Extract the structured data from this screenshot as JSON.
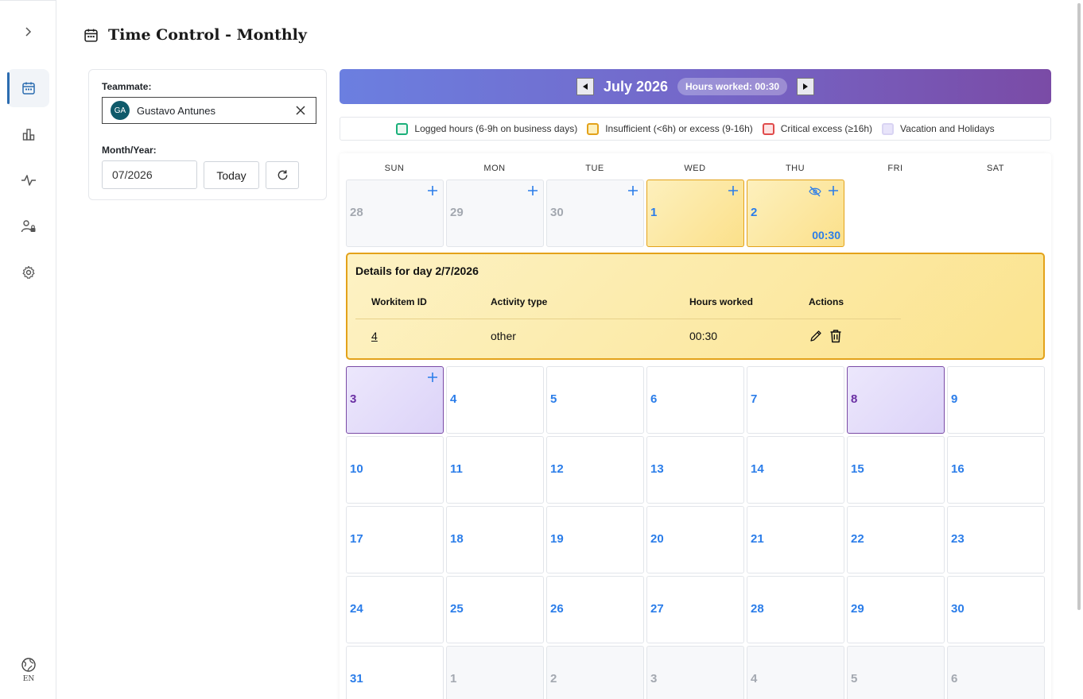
{
  "sidebar": {
    "toggle_icon": "chevron-right-icon",
    "items": [
      {
        "id": "calendar",
        "icon": "calendar-icon",
        "active": true
      },
      {
        "id": "charts",
        "icon": "bar-chart-icon",
        "active": false
      },
      {
        "id": "activity",
        "icon": "activity-icon",
        "active": false
      },
      {
        "id": "users",
        "icon": "user-lock-icon",
        "active": false
      },
      {
        "id": "settings",
        "icon": "gear-icon",
        "active": false
      }
    ],
    "language": "EN"
  },
  "header": {
    "title": "Time Control - Monthly",
    "icon": "calendar-icon"
  },
  "filters": {
    "teammate_label": "Teammate:",
    "teammate_initials": "GA",
    "teammate_name": "Gustavo Antunes",
    "month_label": "Month/Year:",
    "month_value": "07/2026",
    "today_label": "Today",
    "refresh_icon": "refresh-icon"
  },
  "calendar": {
    "month_title": "July 2026",
    "hours_worked": "Hours worked: 00:30",
    "colors": {
      "logged": "#1bb07a",
      "insufficient": "#e3a21a",
      "critical": "#e04b4b",
      "vacation": "#c9c2ef",
      "day_number": "#2b7de9",
      "banner_start": "#6b7fe0",
      "banner_end": "#7a4ba6"
    },
    "legend": [
      {
        "label": "Logged hours (6-9h on business days)",
        "color": "#1bb07a",
        "fill": "#eaf8f1"
      },
      {
        "label": "Insufficient (<6h) or excess (9-16h)",
        "color": "#e3a21a",
        "fill": "#fdf0bd"
      },
      {
        "label": "Critical excess (≥16h)",
        "color": "#e04b4b",
        "fill": "#fde3e3"
      },
      {
        "label": "Vacation and Holidays",
        "color": "#d9d4f3",
        "fill": "#e8e4fa"
      }
    ],
    "weekdays": [
      "SUN",
      "MON",
      "TUE",
      "WED",
      "THU",
      "FRI",
      "SAT"
    ],
    "week1": [
      {
        "n": "28",
        "type": "other",
        "plus": true
      },
      {
        "n": "29",
        "type": "other",
        "plus": true
      },
      {
        "n": "30",
        "type": "other",
        "plus": true
      },
      {
        "n": "1",
        "type": "insufficient",
        "plus": true
      },
      {
        "n": "2",
        "type": "insufficient",
        "plus": true,
        "eyeoff": true,
        "hours": "00:30"
      }
    ],
    "details": {
      "title": "Details for day 2/7/2026",
      "columns": [
        "Workitem ID",
        "Activity type",
        "Hours worked",
        "Actions"
      ],
      "rows": [
        {
          "workitem": "4",
          "activity": "other",
          "hours": "00:30"
        }
      ]
    },
    "weeks": [
      [
        {
          "n": "3",
          "type": "vacation",
          "plus": true
        },
        {
          "n": "4"
        },
        {
          "n": "5"
        },
        {
          "n": "6"
        },
        {
          "n": "7"
        },
        {
          "n": "8",
          "type": "vacation"
        },
        {
          "n": "9"
        }
      ],
      [
        {
          "n": "10"
        },
        {
          "n": "11"
        },
        {
          "n": "12"
        },
        {
          "n": "13"
        },
        {
          "n": "14"
        },
        {
          "n": "15"
        },
        {
          "n": "16"
        }
      ],
      [
        {
          "n": "17"
        },
        {
          "n": "18"
        },
        {
          "n": "19"
        },
        {
          "n": "20"
        },
        {
          "n": "21"
        },
        {
          "n": "22"
        },
        {
          "n": "23"
        }
      ],
      [
        {
          "n": "24"
        },
        {
          "n": "25"
        },
        {
          "n": "26"
        },
        {
          "n": "27"
        },
        {
          "n": "28"
        },
        {
          "n": "29"
        },
        {
          "n": "30"
        }
      ],
      [
        {
          "n": "31"
        },
        {
          "n": "1",
          "type": "other"
        },
        {
          "n": "2",
          "type": "other"
        },
        {
          "n": "3",
          "type": "other"
        },
        {
          "n": "4",
          "type": "other"
        },
        {
          "n": "5",
          "type": "other"
        },
        {
          "n": "6",
          "type": "other"
        }
      ]
    ]
  }
}
